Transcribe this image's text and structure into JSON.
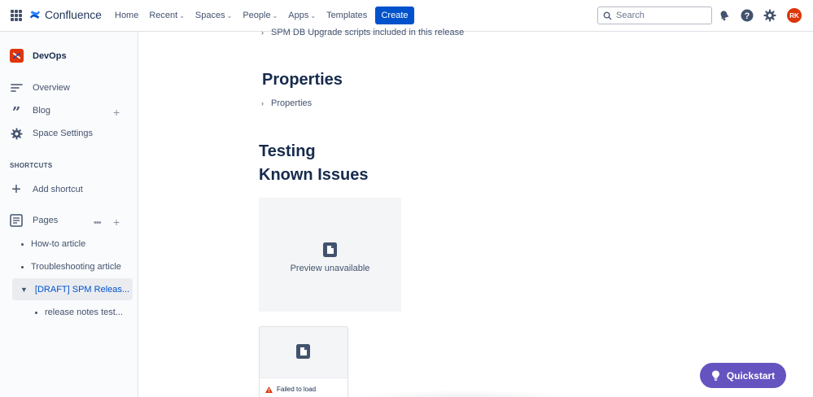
{
  "nav": {
    "logo_text": "Confluence",
    "items": [
      {
        "label": "Home",
        "dropdown": false
      },
      {
        "label": "Recent",
        "dropdown": true
      },
      {
        "label": "Spaces",
        "dropdown": true
      },
      {
        "label": "People",
        "dropdown": true
      },
      {
        "label": "Apps",
        "dropdown": true
      },
      {
        "label": "Templates",
        "dropdown": false
      }
    ],
    "create_label": "Create",
    "search_placeholder": "Search",
    "avatar_initials": "RK",
    "brand_color": "#0052CC"
  },
  "sidebar": {
    "space_name": "DevOps",
    "items": [
      {
        "label": "Overview",
        "icon": "overview-icon"
      },
      {
        "label": "Blog",
        "icon": "quote-icon"
      },
      {
        "label": "Space Settings",
        "icon": "gear-icon"
      }
    ],
    "shortcuts_title": "SHORTCUTS",
    "add_shortcut_label": "Add shortcut",
    "pages_label": "Pages",
    "tree": [
      {
        "label": "How-to article"
      },
      {
        "label": "Troubleshooting article"
      },
      {
        "label": "[DRAFT] SPM Releas...",
        "selected": true
      },
      {
        "label": "release notes test..."
      }
    ]
  },
  "main": {
    "top_expand_label": "SPM DB Upgrade scripts included in this release",
    "properties_heading": "Properties",
    "properties_expand_label": "Properties",
    "testing_heading": "Testing",
    "known_issues_heading": "Known Issues",
    "preview_text": "Preview unavailable",
    "failed_text": "Failed to load"
  },
  "quickstart_label": "Quickstart",
  "colors": {
    "quickstart": "#6554C0",
    "avatar": "#DE350B",
    "selected_text": "#0052CC"
  }
}
